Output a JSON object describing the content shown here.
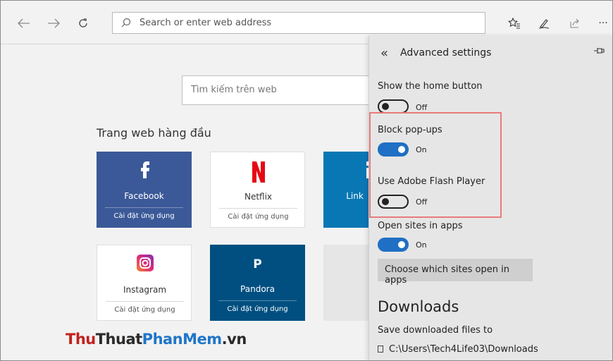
{
  "toolbar": {
    "back_icon": "arrow-left",
    "forward_icon": "arrow-right",
    "refresh_icon": "refresh",
    "address_placeholder": "Search or enter web address",
    "favorites_icon": "favorites-star",
    "notes_icon": "pen",
    "share_icon": "share",
    "more_label": "···"
  },
  "newtab": {
    "search_placeholder": "Tìm kiếm trên web",
    "section_title": "Trang web hàng đầu",
    "tiles": [
      {
        "name": "Facebook",
        "install": "Cài đặt ứng dụng",
        "icon": "f",
        "style": "dark",
        "bg": "#3b5998"
      },
      {
        "name": "Netflix",
        "install": "Cài đặt ứng dụng",
        "icon": "N",
        "style": "light",
        "icon_color": "#e50914"
      },
      {
        "name": "Link",
        "install": "",
        "icon": "in",
        "style": "dark",
        "bg": "#0a77b5"
      },
      {
        "name": "Instagram",
        "install": "Cài đặt ứng dụng",
        "icon": "instagram",
        "style": "light"
      },
      {
        "name": "Pandora",
        "install": "Cài đặt ứng dụng",
        "icon": "P",
        "style": "dark",
        "bg": "#004f80"
      },
      {
        "name": "",
        "install": "",
        "icon": "",
        "style": "empty",
        "bg": "#e6e6e6"
      }
    ]
  },
  "settings": {
    "title": "Advanced settings",
    "back_icon": "double-chevron-left",
    "pin_icon": "pin",
    "home_button": {
      "label": "Show the home button",
      "state": "Off"
    },
    "popups": {
      "label": "Block pop-ups",
      "state": "On"
    },
    "flash": {
      "label": "Use Adobe Flash Player",
      "state": "Off"
    },
    "open_apps": {
      "label": "Open sites in apps",
      "state": "On"
    },
    "choose_sites_button": "Choose which sites open in apps",
    "downloads_heading": "Downloads",
    "save_label": "Save downloaded files to",
    "download_path": "C:\\Users\\Tech4Life03\\Downloads",
    "accent_color": "#1f6fc4",
    "highlight_color": "#ea7a7a"
  },
  "watermark": {
    "part1": "Thu",
    "part2": "Thuat",
    "part3": "PhanMem",
    "part4": ".vn"
  }
}
